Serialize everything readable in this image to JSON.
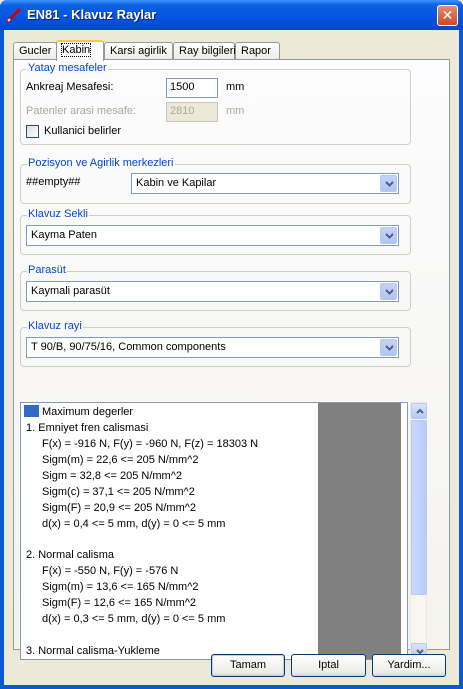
{
  "window": {
    "title": "EN81 - Klavuz Raylar",
    "close_symbol": "✕"
  },
  "tabs": [
    {
      "label": "Gucler",
      "active": false
    },
    {
      "label": "Kabin",
      "active": true
    },
    {
      "label": "Karsi agirlik",
      "active": false
    },
    {
      "label": "Ray bilgileri",
      "active": false
    },
    {
      "label": "Rapor",
      "active": false
    }
  ],
  "yatay": {
    "legend": "Yatay mesafeler",
    "ankreaj_label": "Ankreaj Mesafesi:",
    "ankreaj_value": "1500",
    "ankreaj_unit": "mm",
    "paten_label": "Patenler arasi mesafe:",
    "paten_value": "2810",
    "paten_unit": "mm",
    "kullanici_label": "Kullanici belirler",
    "kullanici_checked": false
  },
  "pozisyon": {
    "legend": "Pozisyon ve Agirlik merkezleri",
    "label": "##empty##",
    "selected": "Kabin ve Kapilar"
  },
  "klavuz_sekli": {
    "legend": "Klavuz Sekli",
    "selected": "Kayma Paten"
  },
  "parasut": {
    "legend": "Parasüt",
    "selected": "Kaymali parasüt"
  },
  "klavuz_rayi": {
    "legend": "Klavuz rayi",
    "selected": "T 90/B, 90/75/16, Common components"
  },
  "results": {
    "header": "Maximum degerler",
    "lines": [
      "1.   Emniyet fren  calismasi",
      "F(x) = -916 N, F(y) = -960 N, F(z) = 18303 N",
      "Sigm(m) = 22,6 <= 205 N/mm^2",
      "Sigm = 32,8 <= 205 N/mm^2",
      "Sigm(c) = 37,1 <= 205 N/mm^2",
      "Sigm(F) = 20,9 <= 205 N/mm^2",
      "d(x) = 0,4 <= 5 mm, d(y) = 0 <= 5 mm",
      "2.   Normal calisma",
      "F(x) = -550 N, F(y) = -576 N",
      "Sigm(m) = 13,6 <= 165 N/mm^2",
      "Sigm(F) = 12,6 <= 165 N/mm^2",
      "d(x) = 0,3 <= 5 mm, d(y) = 0 <= 5 mm",
      "3.   Normal calisma-Yukleme"
    ]
  },
  "buttons": {
    "ok": "Tamam",
    "cancel": "Iptal",
    "help": "Yardim..."
  },
  "colors": {
    "titlebar": "#0554e3",
    "group_legend": "#0046d5",
    "close_button": "#c94a22"
  }
}
